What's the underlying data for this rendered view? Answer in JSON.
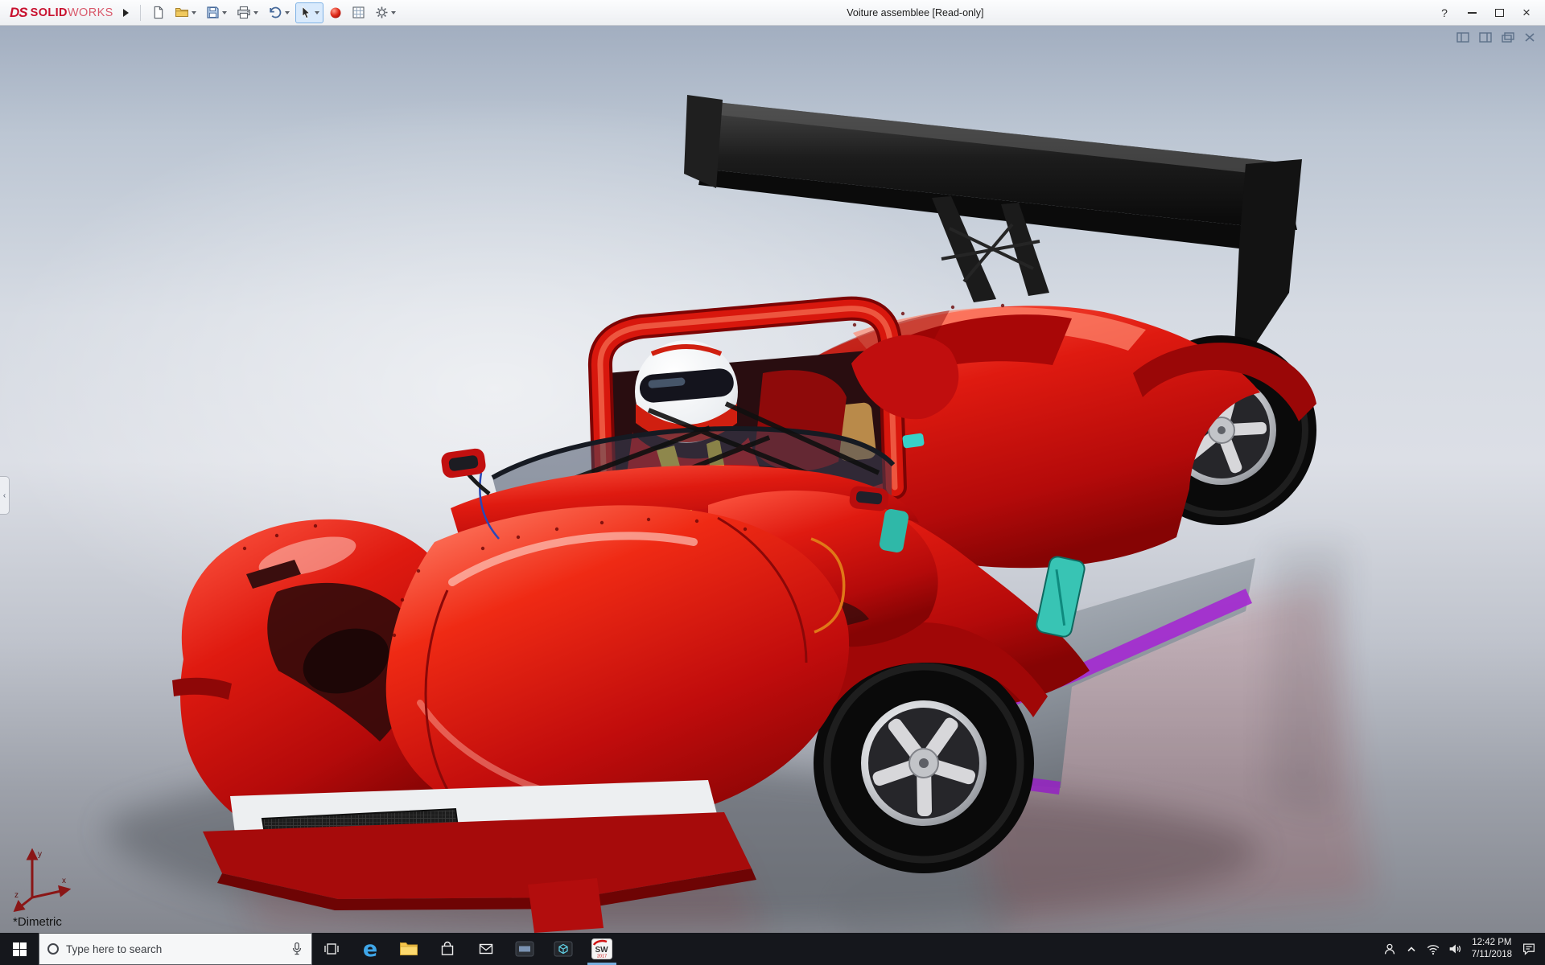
{
  "titlebar": {
    "logo": {
      "mark": "DS",
      "bold": "SOLID",
      "light": "WORKS"
    },
    "document_title": "Voiture assemblee [Read-only]",
    "controls": {
      "help": "?",
      "close": "×"
    }
  },
  "toolbar": {
    "tools": [
      "new-document",
      "open",
      "save",
      "print",
      "undo",
      "select",
      "appearance",
      "evaluate",
      "options"
    ]
  },
  "viewport": {
    "view_label": "*Dimetric",
    "triad": {
      "x": "x",
      "y": "y",
      "z": "z"
    }
  },
  "taskbar": {
    "search": {
      "placeholder": "Type here to search"
    },
    "edge_glyph": "e",
    "solidworks_badge": {
      "text": "SW",
      "year": "2017"
    },
    "apps": [
      "task-view",
      "edge",
      "file-explorer",
      "store",
      "mail",
      "media-app",
      "3d-viewer",
      "solidworks"
    ],
    "tray": {
      "time": "12:42 PM",
      "date": "7/11/2018"
    }
  },
  "colors": {
    "car_red": "#d01010",
    "accent_teal": "#38c4b4",
    "accent_purple": "#a42ad0",
    "harness_yellow": "#e2c93c",
    "wing_black": "#161616",
    "viewport_gradient_top": "#a2aec0",
    "viewport_gradient_bottom": "#84878f",
    "taskbar_bg": "#15171c"
  }
}
